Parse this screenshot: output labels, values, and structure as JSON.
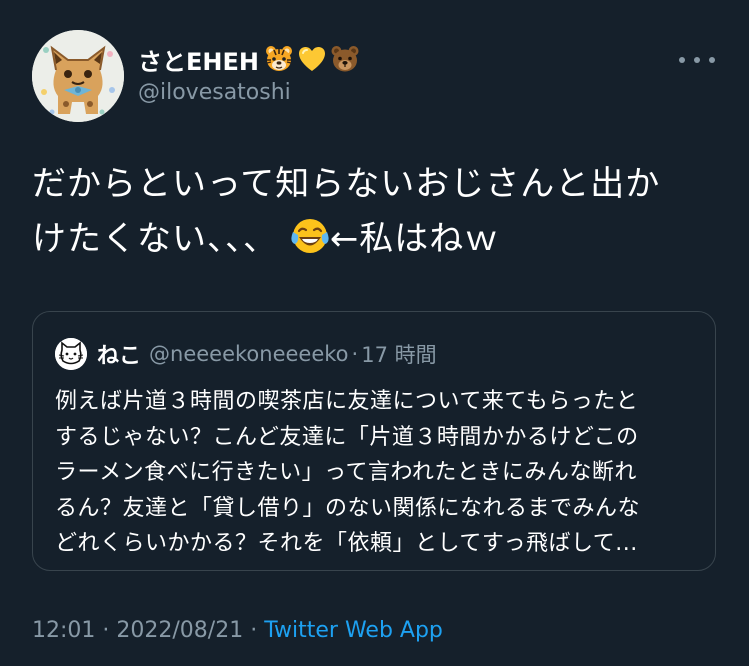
{
  "tweet": {
    "author": {
      "display_name": "さとEHEH",
      "name_emojis": [
        "tiger-face-emoji",
        "yellow-heart-emoji",
        "bear-face-emoji"
      ],
      "handle": "@ilovesatoshi"
    },
    "text_lines": [
      "だからといって知らないおじさんと出か",
      "けたくない、、、",
      "←私はねｗ"
    ],
    "text_emoji": "face-with-tears-of-joy-emoji",
    "quoted": {
      "display_name": "ねこ",
      "handle": "@neeeekoneeeeko",
      "separator": "·",
      "time": "17 時間",
      "body_lines": [
        "例えば片道３時間の喫茶店に友達について来てもらったと",
        "するじゃない？こんど友達に「片道３時間かかるけどこの",
        "ラーメン食べに行きたい」って言われたときにみんな断れ",
        "るん？友達と「貸し借り」のない関係になれるまでみんな",
        "どれくらいかかる？それを「依頼」としてすっ飛ばして..."
      ]
    },
    "footer": {
      "time": "12:01",
      "sep1": "·",
      "date": "2022/08/21",
      "sep2": "·",
      "source": "Twitter Web App"
    }
  },
  "colors": {
    "background": "#15202b",
    "text_primary": "#ffffff",
    "text_secondary": "#8899a6",
    "link": "#1da1f2",
    "border": "#38444d"
  }
}
